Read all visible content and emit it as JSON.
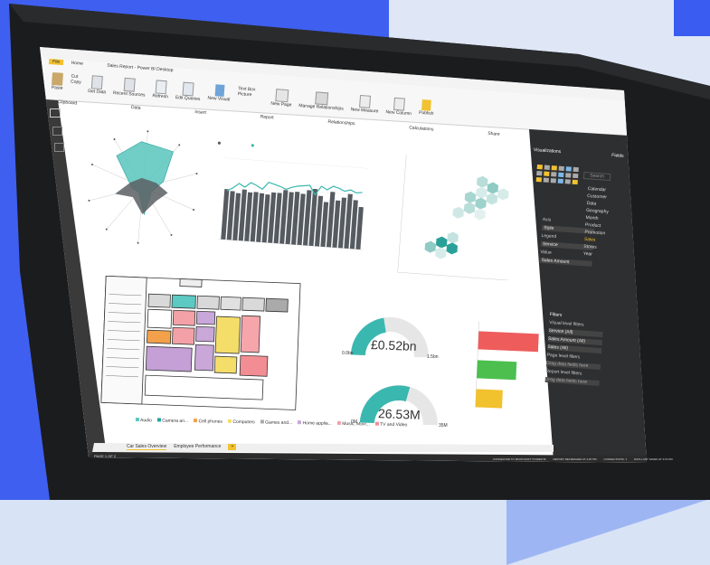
{
  "app": {
    "window_title": "Sales Report - Power BI Desktop",
    "file_tab": "File",
    "home_tab": "Home"
  },
  "ribbon": {
    "paste": "Paste",
    "cut": "Cut",
    "copy": "Copy",
    "format_painter": "Format Painter",
    "clipboard": "Clipboard",
    "get_data": "Get Data",
    "recent_sources": "Recent Sources",
    "refresh": "Refresh",
    "edit_queries": "Edit Queries",
    "data": "Data",
    "new_visual": "New Visual",
    "text_box": "Text Box",
    "picture": "Picture",
    "insert": "Insert",
    "new_page": "New Page",
    "report": "Report",
    "manage_relationships": "Manage Relationships",
    "relationships": "Relationships",
    "new_measure": "New Measure",
    "new_column": "New Column",
    "calculations": "Calculations",
    "publish": "Publish",
    "share": "Share"
  },
  "canvas": {
    "gauge1_value": "£0.52bn",
    "gauge2_value": "26.53M",
    "gauge1_min": "0.0bn",
    "gauge1_max": "1.5bn",
    "gauge2_min": "0M",
    "gauge2_max": "35M",
    "legend_items": [
      "Audio",
      "Camera an...",
      "Cell phones",
      "Computers",
      "Games and...",
      "Home applia...",
      "Music, Movi...",
      "TV and Video"
    ]
  },
  "visualizations": {
    "tab_visualizations": "Visualizations",
    "tab_fields": "Fields",
    "search_placeholder": "Search",
    "field_items": [
      "Calendar",
      "Customer",
      "Data",
      "Geography",
      "Month",
      "Product",
      "Promotion",
      "Sales",
      "Stores",
      "Year"
    ],
    "filters_title": "Filters",
    "field_wells": [
      "Axis",
      "Style",
      "Legend",
      "Service",
      "Value",
      "Sales Amount"
    ],
    "filter_items": [
      "Visual level filters",
      "Service (All)",
      "Sales Amount (All)",
      "Sales (All)",
      "Page level filters",
      "Drag data fields here",
      "Report level filters",
      "Drag data fields here"
    ]
  },
  "pages": {
    "tabs": [
      "Car Sales Overview",
      "Employee Performance"
    ],
    "add": "+",
    "page_indicator": "PAGE 1 OF 2",
    "status_connected": "CONNECTED TO MICROSOFT POWER BI",
    "status_update": "REPORT REFRESHED AT 4:26 PM",
    "status_conn": "CONNECTIONS: 1",
    "status_right": "DATA LAST SAVED AT 4:15 PM"
  },
  "chart_data": {
    "type": "bar",
    "values": [
      62,
      60,
      58,
      63,
      60,
      61,
      60,
      59,
      62,
      62,
      66,
      64,
      65,
      63,
      68,
      70,
      62,
      55,
      68,
      58,
      62,
      67,
      60,
      52
    ],
    "line_values": [
      60,
      64,
      70,
      66,
      72,
      69,
      65,
      74,
      72,
      70,
      67,
      70,
      72,
      73,
      74,
      63,
      74,
      70,
      75,
      73,
      70,
      72,
      69,
      70
    ],
    "ylim": [
      0,
      100
    ]
  },
  "funnel": {
    "values": [
      0.95,
      0.62,
      0.42
    ]
  },
  "colors": {
    "teal": "#3ab8b0",
    "gray_bar": "#555b60",
    "red": "#ee5c5c",
    "green": "#4cbf4f",
    "yellow": "#f2c12e"
  }
}
